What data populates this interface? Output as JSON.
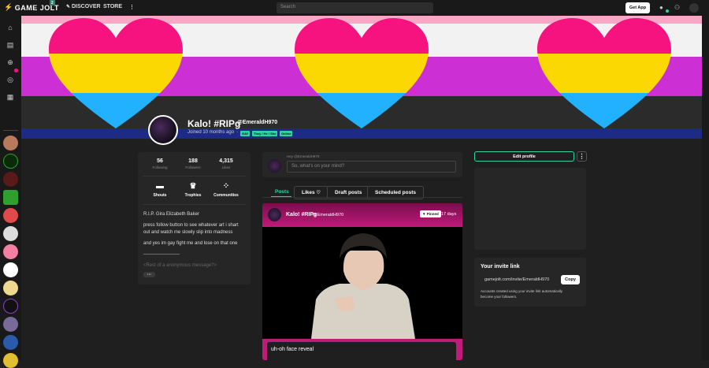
{
  "topbar": {
    "logo_text": "GAME JOLT",
    "logo_badge": "2",
    "nav_discover": "DISCOVER",
    "nav_store": "STORE",
    "more_glyph": "⋮",
    "search_placeholder": "Search",
    "get_app_label": "Get App"
  },
  "profile": {
    "display_name": "Kalo! #RIPg",
    "username": "@EmeraldH970",
    "joined": "Joined 10 months ago",
    "separator": "·",
    "tags": [
      "GAY",
      "They / He / She",
      "Online"
    ]
  },
  "stats": [
    {
      "value": "56",
      "label": "Following"
    },
    {
      "value": "188",
      "label": "Followers"
    },
    {
      "value": "4,315",
      "label": "Likes"
    }
  ],
  "quick_links": [
    {
      "label": "Shouts",
      "icon": "chat-bubble-icon"
    },
    {
      "label": "Trophies",
      "icon": "trophy-icon"
    },
    {
      "label": "Communities",
      "icon": "communities-icon"
    }
  ],
  "bio": {
    "line1": "R.I.P. Gira Elizabeth Baker",
    "line2": "press follow button to see whatever art i shart",
    "line3": "out and watch me slowly slip into madness",
    "line4": "and yes im gay fight me and lose on that one",
    "line5": "-----------------------",
    "line6": "<Rest of a anonymous message?>",
    "more_button": "···"
  },
  "composer": {
    "greeting": "Hey @EmeraldH970",
    "placeholder": "So, what's on your mind?"
  },
  "tabs": [
    {
      "label": "Posts",
      "active": true
    },
    {
      "label": "Likes"
    },
    {
      "label": "Draft posts"
    },
    {
      "label": "Scheduled posts"
    }
  ],
  "likes_icon": "heart-icon",
  "post": {
    "author": "Kalo! #RIPg",
    "username": "@EmeraldH970",
    "pinned_label": "Pinned",
    "age": "17 days",
    "caption": "uh-oh face reveal"
  },
  "right": {
    "edit_profile_label": "Edit profile",
    "more_glyph": "⋮",
    "invite_title": "Your invite link",
    "invite_url": "gamejolt.com/invite/EmeraldH970",
    "copy_label": "Copy",
    "invite_desc_1": "Accounts created using your invite link automatically",
    "invite_desc_2": "become your followers."
  },
  "colors": {
    "accent": "#2fd4a4",
    "pink": "#f7137f",
    "yellow": "#fcd803",
    "purple": "#cc2fd4",
    "blue": "#21b1ff"
  }
}
